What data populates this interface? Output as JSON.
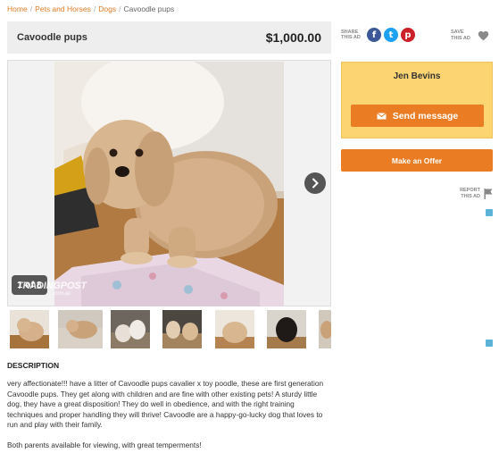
{
  "breadcrumb": {
    "items": [
      "Home",
      "Pets and Horses",
      "Dogs"
    ],
    "current": "Cavoodle pups"
  },
  "listing": {
    "title": "Cavoodle pups",
    "price": "$1,000.00"
  },
  "share": {
    "label_line1": "SHARE",
    "label_line2": "THIS AD",
    "facebook_glyph": "f",
    "twitter_glyph": "t",
    "pinterest_glyph": "p",
    "icons": [
      "facebook-icon",
      "twitter-icon",
      "pinterest-icon"
    ]
  },
  "save": {
    "label_line1": "SAVE",
    "label_line2": "THIS AD",
    "icon": "heart-icon"
  },
  "gallery": {
    "counter": "1 of 8",
    "watermark": "TRADINGPOST",
    "watermark_sub": ".com.au",
    "thumbnail_count": 7
  },
  "seller": {
    "name": "Jen Bevins",
    "send_label": "Send message"
  },
  "offer": {
    "label": "Make an Offer"
  },
  "report": {
    "label_line1": "REPORT",
    "label_line2": "THIS AD",
    "icon": "flag-icon"
  },
  "description": {
    "heading": "DESCRIPTION",
    "paragraph1": "very affectionate!!! have a litter of Cavoodle pups cavalier x toy poodle, these are first generation Cavoodle pups. They get along with children and are fine with other existing pets! A sturdy little dog, they have a great disposition! They do well in obedience, and with the right training techniques and proper handling they will thrive! Cavoodle are a happy-go-lucky dog that loves to run and play with their family.",
    "paragraph2": "Both parents available for viewing, with great temperments!"
  },
  "colors": {
    "accent": "#ea7d23",
    "seller_box": "#fcd472",
    "link": "#e07b24"
  }
}
